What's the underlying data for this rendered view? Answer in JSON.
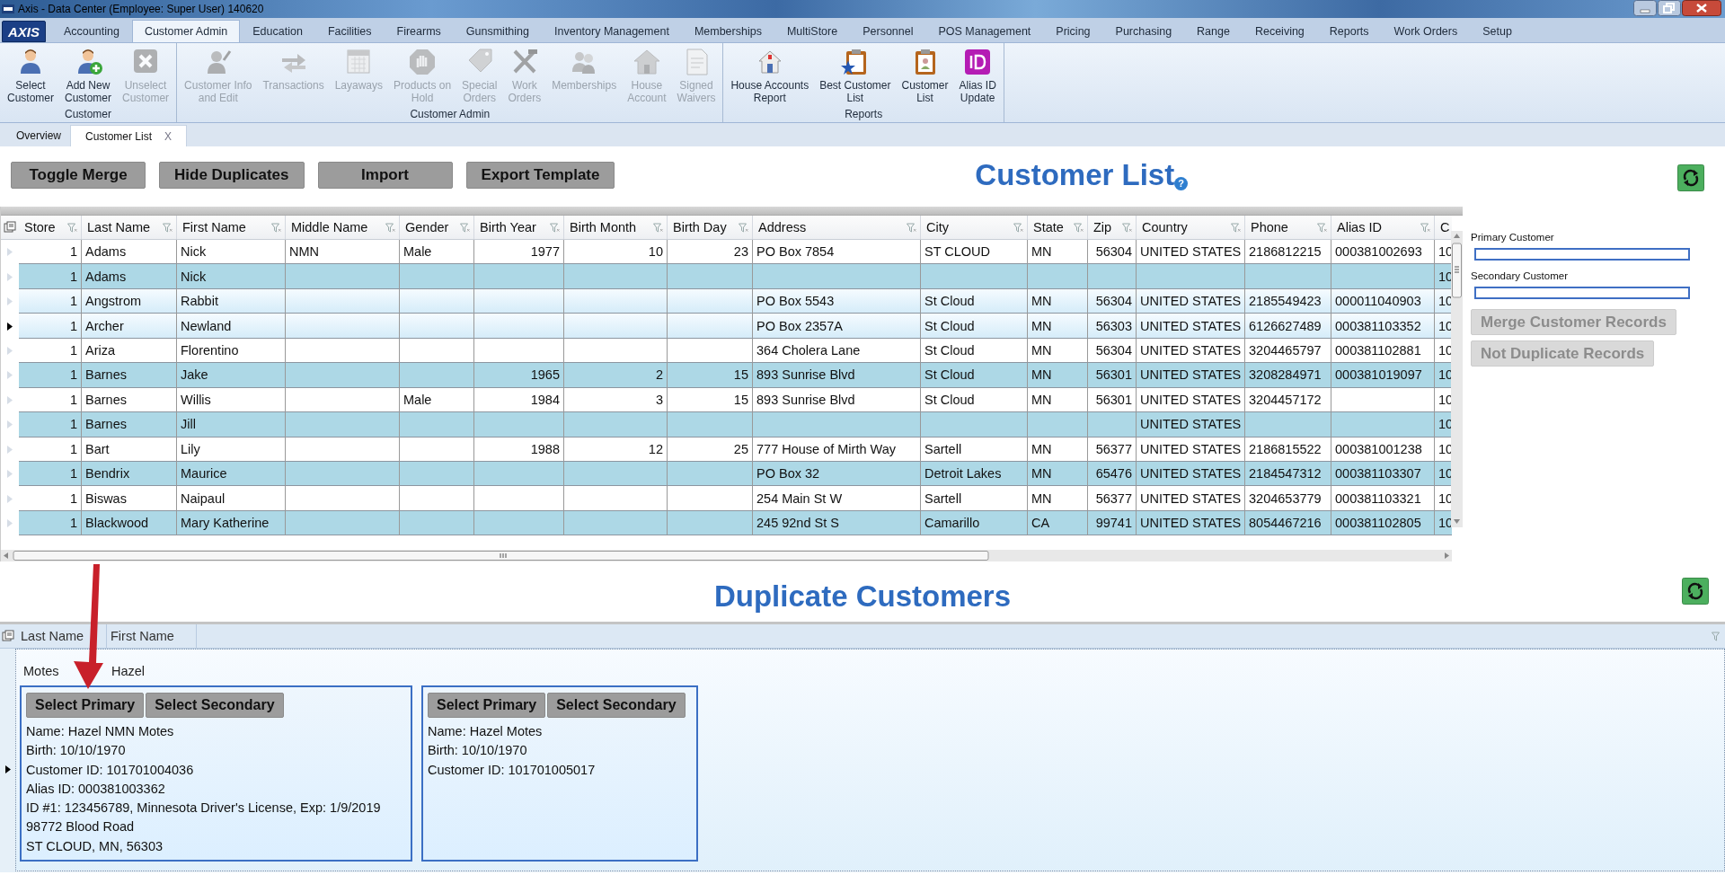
{
  "window": {
    "title": "Axis - Data Center  (Employee: Super User) 140620",
    "logo": "AXIS"
  },
  "ribbon_tabs": [
    {
      "label": "Accounting",
      "selected": false
    },
    {
      "label": "Customer Admin",
      "selected": true
    },
    {
      "label": "Education",
      "selected": false
    },
    {
      "label": "Facilities",
      "selected": false
    },
    {
      "label": "Firearms",
      "selected": false
    },
    {
      "label": "Gunsmithing",
      "selected": false
    },
    {
      "label": "Inventory Management",
      "selected": false
    },
    {
      "label": "Memberships",
      "selected": false
    },
    {
      "label": "MultiStore",
      "selected": false
    },
    {
      "label": "Personnel",
      "selected": false
    },
    {
      "label": "POS Management",
      "selected": false
    },
    {
      "label": "Pricing",
      "selected": false
    },
    {
      "label": "Purchasing",
      "selected": false
    },
    {
      "label": "Range",
      "selected": false
    },
    {
      "label": "Receiving",
      "selected": false
    },
    {
      "label": "Reports",
      "selected": false
    },
    {
      "label": "Work Orders",
      "selected": false
    },
    {
      "label": "Setup",
      "selected": false
    }
  ],
  "ribbon_groups": [
    {
      "title": "Customer",
      "items": [
        {
          "label": "Select\nCustomer",
          "disabled": false
        },
        {
          "label": "Add New\nCustomer",
          "disabled": false
        },
        {
          "label": "Unselect\nCustomer",
          "disabled": true
        }
      ]
    },
    {
      "title": "Customer Admin",
      "items": [
        {
          "label": "Customer Info\nand Edit",
          "disabled": true
        },
        {
          "label": "Transactions",
          "disabled": true
        },
        {
          "label": "Layaways",
          "disabled": true
        },
        {
          "label": "Products on\nHold",
          "disabled": true
        },
        {
          "label": "Special\nOrders",
          "disabled": true
        },
        {
          "label": "Work\nOrders",
          "disabled": true
        },
        {
          "label": "Memberships",
          "disabled": true
        },
        {
          "label": "House\nAccount",
          "disabled": true
        },
        {
          "label": "Signed\nWaivers",
          "disabled": true
        }
      ]
    },
    {
      "title": "Reports",
      "items": [
        {
          "label": "House Accounts\nReport",
          "disabled": false
        },
        {
          "label": "Best Customer\nList",
          "disabled": false
        },
        {
          "label": "Customer\nList",
          "disabled": false
        },
        {
          "label": "Alias ID\nUpdate",
          "disabled": false
        }
      ]
    }
  ],
  "document_tabs": [
    {
      "label": "Overview",
      "selected": false
    },
    {
      "label": "Customer List",
      "selected": true,
      "close": "X"
    }
  ],
  "toolbar": [
    "Toggle Merge",
    "Hide Duplicates",
    "Import",
    "Export Template"
  ],
  "customer_list": {
    "title": "Customer List",
    "help": "?",
    "columns": [
      {
        "label": "Store",
        "kind": "number"
      },
      {
        "label": "Last Name",
        "kind": "text"
      },
      {
        "label": "First Name",
        "kind": "text"
      },
      {
        "label": "Middle Name",
        "kind": "text"
      },
      {
        "label": "Gender",
        "kind": "text"
      },
      {
        "label": "Birth Year",
        "kind": "number"
      },
      {
        "label": "Birth Month",
        "kind": "number"
      },
      {
        "label": "Birth Day",
        "kind": "number"
      },
      {
        "label": "Address",
        "kind": "text"
      },
      {
        "label": "City",
        "kind": "text"
      },
      {
        "label": "State",
        "kind": "text"
      },
      {
        "label": "Zip",
        "kind": "number"
      },
      {
        "label": "Country",
        "kind": "text"
      },
      {
        "label": "Phone",
        "kind": "text"
      },
      {
        "label": "Alias ID",
        "kind": "text"
      },
      {
        "label": "C",
        "kind": "text"
      }
    ],
    "rows": [
      {
        "selected": false,
        "current": false,
        "cells": [
          "1",
          "Adams",
          "Nick",
          "NMN",
          "Male",
          "1977",
          "10",
          "23",
          "PO Box 7854",
          "ST CLOUD",
          "MN",
          "56304",
          "UNITED STATES",
          "2186812215",
          "000381002693",
          "10"
        ]
      },
      {
        "selected": false,
        "current": false,
        "cells": [
          "1",
          "Adams",
          "Nick",
          null,
          null,
          null,
          null,
          null,
          null,
          null,
          null,
          null,
          null,
          null,
          null,
          "10"
        ]
      },
      {
        "selected": true,
        "current": false,
        "cells": [
          "1",
          "Angstrom",
          "Rabbit",
          null,
          null,
          null,
          null,
          null,
          "PO Box 5543",
          "St Cloud",
          "MN",
          "56304",
          "UNITED STATES",
          "2185549423",
          "000011040903",
          "10"
        ]
      },
      {
        "selected": true,
        "current": true,
        "cells": [
          "1",
          "Archer",
          "Newland",
          null,
          null,
          null,
          null,
          null,
          "PO Box 2357A",
          "St Cloud",
          "MN",
          "56303",
          "UNITED STATES",
          "6126627489",
          "000381103352",
          "10"
        ]
      },
      {
        "selected": false,
        "current": false,
        "cells": [
          "1",
          "Ariza",
          "Florentino",
          null,
          null,
          null,
          null,
          null,
          "364 Cholera Lane",
          "St Cloud",
          "MN",
          "56304",
          "UNITED STATES",
          "3204465797",
          "000381102881",
          "10"
        ]
      },
      {
        "selected": false,
        "current": false,
        "cells": [
          "1",
          "Barnes",
          "Jake",
          null,
          null,
          "1965",
          "2",
          "15",
          "893 Sunrise Blvd",
          "St Cloud",
          "MN",
          "56301",
          "UNITED STATES",
          "3208284971",
          "000381019097",
          "10"
        ]
      },
      {
        "selected": false,
        "current": false,
        "cells": [
          "1",
          "Barnes",
          "Willis",
          null,
          "Male",
          "1984",
          "3",
          "15",
          "893 Sunrise Blvd",
          "St Cloud",
          "MN",
          "56301",
          "UNITED STATES",
          "3204457172",
          null,
          "10"
        ]
      },
      {
        "selected": false,
        "current": false,
        "cells": [
          "1",
          "Barnes",
          "Jill",
          null,
          null,
          null,
          null,
          null,
          null,
          null,
          null,
          null,
          "UNITED STATES",
          null,
          null,
          "10"
        ]
      },
      {
        "selected": false,
        "current": false,
        "cells": [
          "1",
          "Bart",
          "Lily",
          null,
          null,
          "1988",
          "12",
          "25",
          "777 House of Mirth Way",
          "Sartell",
          "MN",
          "56377",
          "UNITED STATES",
          "2186815522",
          "000381001238",
          "10"
        ]
      },
      {
        "selected": false,
        "current": false,
        "cells": [
          "1",
          "Bendrix",
          "Maurice",
          null,
          null,
          null,
          null,
          null,
          "PO Box 32",
          "Detroit Lakes",
          "MN",
          "65476",
          "UNITED STATES",
          "2184547312",
          "000381103307",
          "10"
        ]
      },
      {
        "selected": false,
        "current": false,
        "cells": [
          "1",
          "Biswas",
          "Naipaul",
          null,
          null,
          null,
          null,
          null,
          "254 Main St W",
          "Sartell",
          "MN",
          "56377",
          "UNITED STATES",
          "3204653779",
          "000381103321",
          "10"
        ]
      },
      {
        "selected": false,
        "current": false,
        "cells": [
          "1",
          "Blackwood",
          "Mary Katherine",
          null,
          null,
          null,
          null,
          null,
          "245 92nd St S",
          "Camarillo",
          "CA",
          "99741",
          "UNITED STATES",
          "8054467216",
          "000381102805",
          "10"
        ]
      }
    ]
  },
  "merge_panel": {
    "primary_label": "Primary Customer",
    "secondary_label": "Secondary Customer",
    "buttons": [
      {
        "label": "Merge Customer Records",
        "disabled": true
      },
      {
        "label": "Not Duplicate Records",
        "disabled": true
      }
    ]
  },
  "duplicates": {
    "title": "Duplicate Customers",
    "columns": [
      "Last Name",
      "First Name"
    ],
    "group": {
      "last_name": "Motes",
      "first_name": "Hazel",
      "current": true,
      "cards": [
        {
          "buttons": [
            "Select Primary",
            "Select Secondary"
          ],
          "lines": [
            "Name:  Hazel  NMN Motes",
            "Birth: 10/10/1970",
            "Customer ID: 101701004036",
            "Alias ID: 000381003362",
            "ID #1: 123456789, Minnesota Driver's License, Exp: 1/9/2019",
            "98772 Blood Road",
            "ST CLOUD, MN, 56303"
          ]
        },
        {
          "buttons": [
            "Select Primary",
            "Select Secondary"
          ],
          "lines": [
            "Name:  Hazel  Motes",
            "Birth: 10/10/1970",
            "Customer ID: 101701005017"
          ]
        }
      ]
    }
  }
}
